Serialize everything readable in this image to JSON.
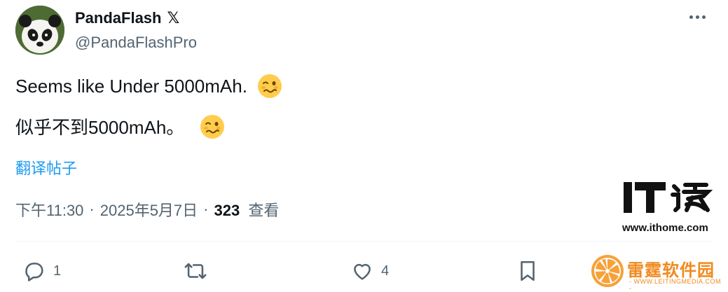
{
  "author": {
    "name": "PandaFlash",
    "badge": "𝕏",
    "handle": "@PandaFlashPro",
    "avatar_icon": "panda-avatar"
  },
  "tweet": {
    "line1": "Seems like Under 5000mAh.",
    "line2": "似乎不到5000mAh。",
    "emoji_icon": "woozy-face-icon",
    "translate_label": "翻译帖子"
  },
  "meta": {
    "time": "下午11:30",
    "sep1": "·",
    "date": "2025年5月7日",
    "sep2": "·",
    "views_count": "323",
    "views_label": "查看"
  },
  "actions": {
    "reply_count": "1",
    "retweet_count": "",
    "like_count": "4"
  },
  "watermarks": {
    "ithome_url": "www.ithome.com",
    "leiting_title": "雷霆软件园",
    "leiting_url": "- WWW.LEITINGMEDIA.COM -"
  },
  "colors": {
    "text": "#0f1419",
    "secondary": "#536471",
    "link": "#1d9bf0",
    "watermark_orange": "#f08a1e"
  }
}
